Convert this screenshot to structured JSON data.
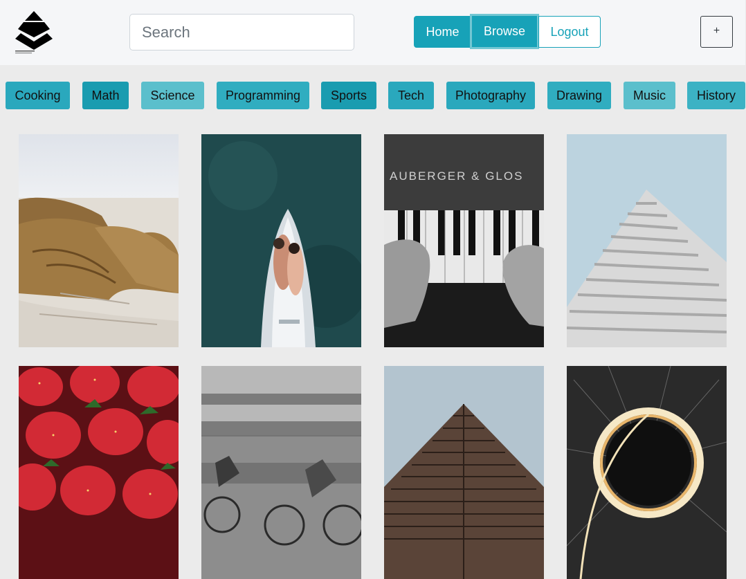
{
  "header": {
    "search": {
      "placeholder": "Search",
      "value": ""
    },
    "nav": [
      {
        "label": "Home"
      },
      {
        "label": "Browse"
      },
      {
        "label": "Logout"
      }
    ],
    "add_label": "+"
  },
  "categories": [
    {
      "label": "Cooking",
      "color": "#2aa8bd"
    },
    {
      "label": "Math",
      "color": "#1a9cb0"
    },
    {
      "label": "Science",
      "color": "#5bbfcc"
    },
    {
      "label": "Programming",
      "color": "#30adc0"
    },
    {
      "label": "Sports",
      "color": "#1a9cb0"
    },
    {
      "label": "Tech",
      "color": "#2aa8bd"
    },
    {
      "label": "Photography",
      "color": "#2aa8bd"
    },
    {
      "label": "Drawing",
      "color": "#30adc0"
    },
    {
      "label": "Music",
      "color": "#5bbfcc"
    },
    {
      "label": "History",
      "color": "#3cb2c4"
    }
  ],
  "photos": [
    {
      "subject": "walruses-on-beach"
    },
    {
      "subject": "couple-on-boat"
    },
    {
      "subject": "piano-keys-hands",
      "text": "AUBERGER & GLOS"
    },
    {
      "subject": "white-building"
    },
    {
      "subject": "strawberries"
    },
    {
      "subject": "blurred-cyclists"
    },
    {
      "subject": "brown-tower"
    },
    {
      "subject": "light-ring"
    }
  ]
}
